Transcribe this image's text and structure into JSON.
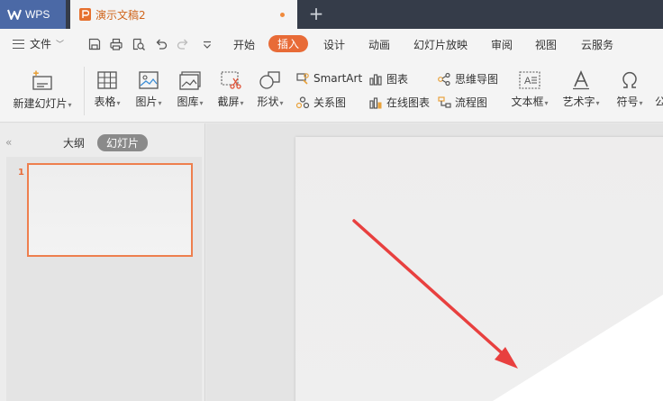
{
  "titlebar": {
    "app_name": "WPS",
    "doc_title": "演示文稿2",
    "new_tab_symbol": "+"
  },
  "menubar": {
    "file_label": "文件",
    "items": [
      {
        "label": "开始"
      },
      {
        "label": "插入",
        "active": true
      },
      {
        "label": "设计"
      },
      {
        "label": "动画"
      },
      {
        "label": "幻灯片放映"
      },
      {
        "label": "审阅"
      },
      {
        "label": "视图"
      },
      {
        "label": "云服务"
      }
    ]
  },
  "ribbon": {
    "new_slide": "新建幻灯片",
    "table": "表格",
    "picture": "图片",
    "gallery": "图库",
    "screenshot": "截屏",
    "shape": "形状",
    "smartart": "SmartArt",
    "relation": "关系图",
    "chart": "图表",
    "online_chart": "在线图表",
    "mindmap": "思维导图",
    "flowchart": "流程图",
    "textbox": "文本框",
    "wordart": "艺术字",
    "symbol": "符号",
    "formula_partial": "公"
  },
  "leftpanel": {
    "collapse_symbol": "«",
    "tab_outline": "大纲",
    "tab_slides": "幻灯片",
    "slide_number": "1"
  },
  "colors": {
    "accent": "#e86b37",
    "titlebar": "#353c49",
    "wps_tab": "#4b69a6",
    "arrow": "#e8403f"
  }
}
